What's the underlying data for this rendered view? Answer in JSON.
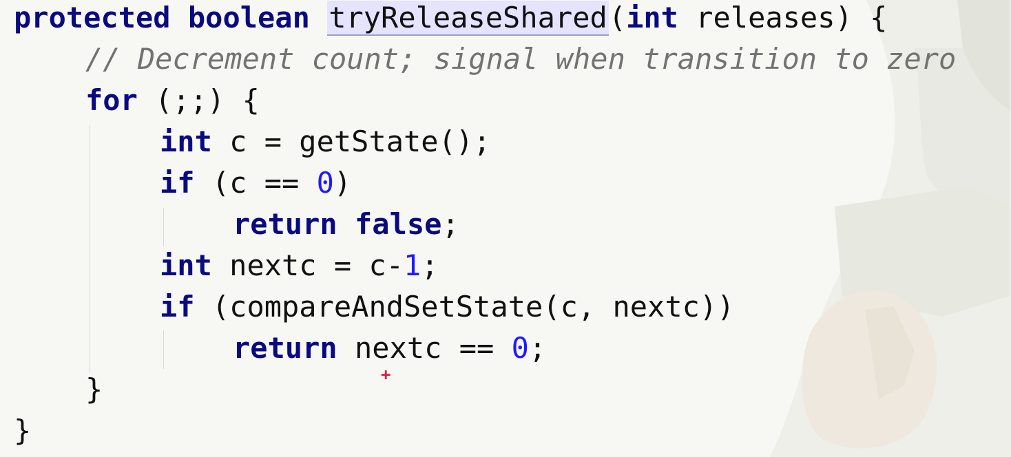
{
  "code": {
    "line1": {
      "kw_protected": "protected",
      "kw_boolean": "boolean",
      "method_name": "tryReleaseShared",
      "open_paren": "(",
      "kw_int": "int",
      "param": "releases",
      "tail": ") {"
    },
    "line2": {
      "comment": "// Decrement count; signal when transition to zero"
    },
    "line3": {
      "kw_for": "for",
      "rest": "(;;) {"
    },
    "line4": {
      "kw_int": "int",
      "rest": "c = getState();"
    },
    "line5": {
      "kw_if": "if",
      "before_num": "(c == ",
      "num": "0",
      "after_num": ")"
    },
    "line6": {
      "kw_return": "return",
      "kw_false": "false",
      "semi": ";"
    },
    "line7": {
      "kw_int": "int",
      "before_num": "nextc = c-",
      "num": "1",
      "after_num": ";"
    },
    "line8": {
      "kw_if": "if",
      "rest": "(compareAndSetState(c, nextc))"
    },
    "line9": {
      "kw_return": "return",
      "before_num": "nextc == ",
      "num": "0",
      "after_num": ";"
    },
    "line10": {
      "brace": "}"
    },
    "line11": {
      "brace": "}"
    }
  },
  "cursor_glyph": "+",
  "colors": {
    "keyword": "#0a0a80",
    "number": "#1f1aff",
    "comment": "#737373",
    "text": "#111111",
    "method_highlight": "#e4e4ff",
    "cursor": "#e21b3b"
  }
}
